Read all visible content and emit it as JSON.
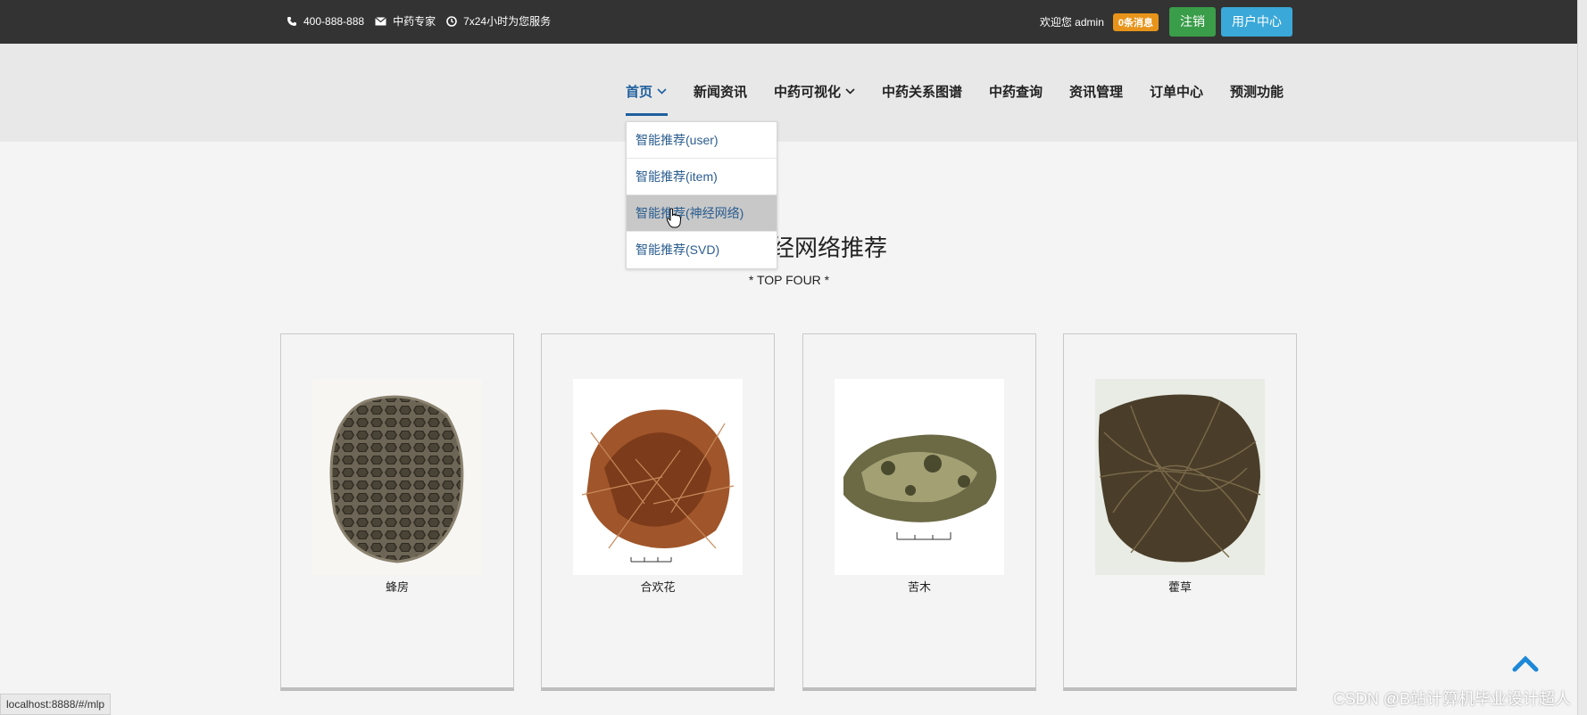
{
  "topbar": {
    "phone": "400-888-888",
    "email_label": "中药专家",
    "service_hours": "7x24小时为您服务",
    "welcome": "欢迎您 admin",
    "messages_badge": "0条消息",
    "logout_label": "注销",
    "user_center_label": "用户中心"
  },
  "nav": {
    "items": [
      {
        "label": "首页",
        "dropdown": true,
        "active": true
      },
      {
        "label": "新闻资讯"
      },
      {
        "label": "中药可视化",
        "dropdown": true
      },
      {
        "label": "中药关系图谱"
      },
      {
        "label": "中药查询"
      },
      {
        "label": "资讯管理"
      },
      {
        "label": "订单中心"
      },
      {
        "label": "预测功能"
      }
    ]
  },
  "dropdown": {
    "items": [
      {
        "label": "智能推荐(user)"
      },
      {
        "label": "智能推荐(item)"
      },
      {
        "label": "智能推荐(神经网络)",
        "hovered": true
      },
      {
        "label": "智能推荐(SVD)"
      }
    ]
  },
  "section": {
    "title_visible": "经网络推荐",
    "subtitle": "* TOP FOUR *"
  },
  "products": [
    {
      "name": "蜂房"
    },
    {
      "name": "合欢花"
    },
    {
      "name": "苦木"
    },
    {
      "name": "藿草"
    }
  ],
  "status_url": "localhost:8888/#/mlp",
  "watermark": "CSDN @B站计算机毕业设计超人",
  "colors": {
    "topbar": "#333333",
    "accent_blue": "#1e5f9e",
    "badge": "#e8941a",
    "logout": "#3a9d49",
    "user_center": "#3aa8d8"
  }
}
